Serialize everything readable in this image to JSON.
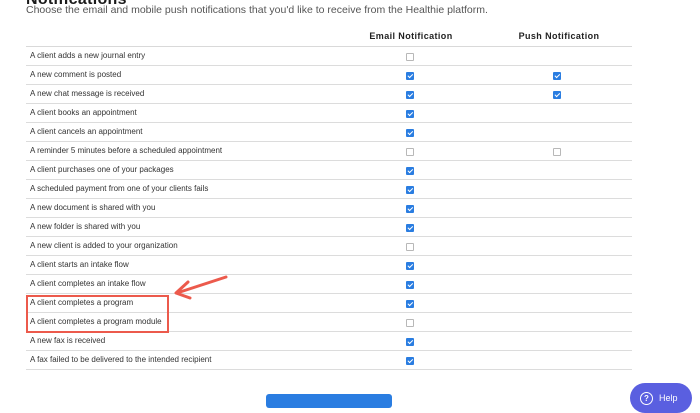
{
  "page": {
    "title": "Notifications",
    "subtitle": "Choose the email and mobile push notifications that you'd like to receive from the Healthie platform."
  },
  "table": {
    "headers": {
      "email": "Email Notification",
      "push": "Push Notification"
    },
    "rows": [
      {
        "label": "A client adds a new journal entry",
        "email": false,
        "push": null
      },
      {
        "label": "A new comment is posted",
        "email": true,
        "push": true
      },
      {
        "label": "A new chat message is received",
        "email": true,
        "push": true
      },
      {
        "label": "A client books an appointment",
        "email": true,
        "push": null
      },
      {
        "label": "A client cancels an appointment",
        "email": true,
        "push": null
      },
      {
        "label": "A reminder 5 minutes before a scheduled appointment",
        "email": false,
        "push": false
      },
      {
        "label": "A client purchases one of your packages",
        "email": true,
        "push": null
      },
      {
        "label": "A scheduled payment from one of your clients fails",
        "email": true,
        "push": null
      },
      {
        "label": "A new document is shared with you",
        "email": true,
        "push": null
      },
      {
        "label": "A new folder is shared with you",
        "email": true,
        "push": null
      },
      {
        "label": "A new client is added to your organization",
        "email": false,
        "push": null
      },
      {
        "label": "A client starts an intake flow",
        "email": true,
        "push": null
      },
      {
        "label": "A client completes an intake flow",
        "email": true,
        "push": null
      },
      {
        "label": "A client completes a program",
        "email": true,
        "push": null
      },
      {
        "label": "A client completes a program module",
        "email": false,
        "push": null
      },
      {
        "label": "A new fax is received",
        "email": true,
        "push": null
      },
      {
        "label": "A fax failed to be delivered to the intended recipient",
        "email": true,
        "push": null
      }
    ]
  },
  "help": {
    "label": "Help"
  },
  "colors": {
    "accent": "#2a7de1",
    "highlight": "#ec5a4c",
    "help_bg": "#5a5fe0"
  }
}
